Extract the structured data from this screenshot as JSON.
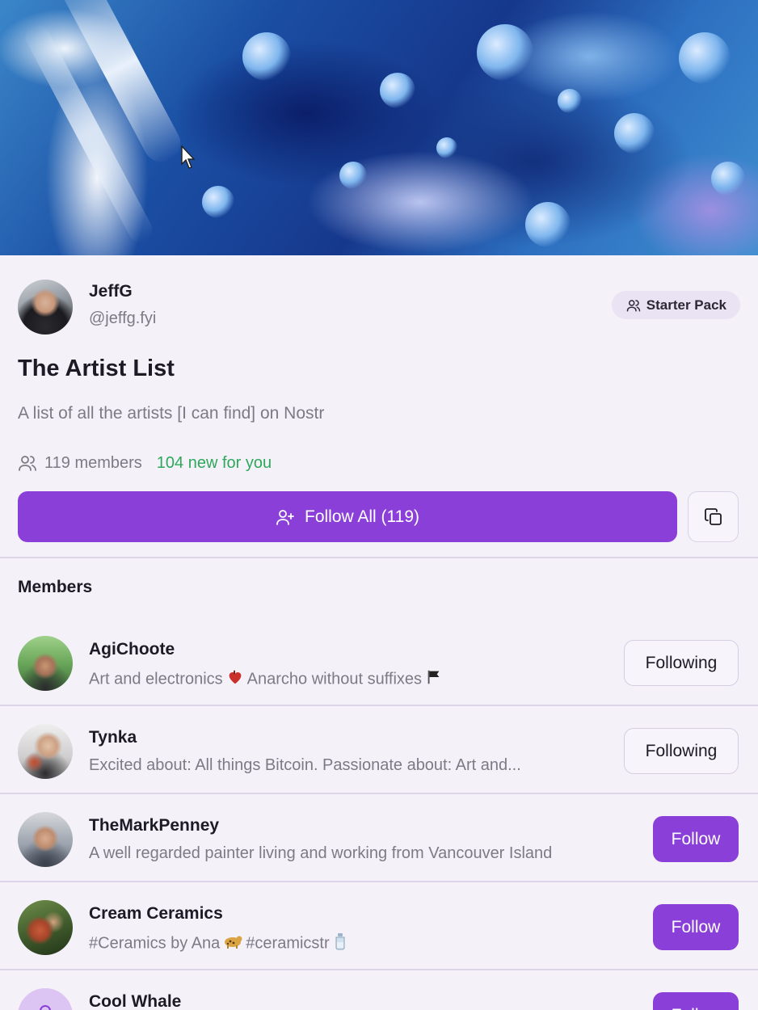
{
  "author": {
    "name": "JeffG",
    "handle": "@jeffg.fyi"
  },
  "badge": {
    "label": "Starter Pack",
    "icon": "users-icon"
  },
  "list": {
    "title": "The Artist List",
    "description": "A list of all the artists [I can find] on Nostr",
    "members_count_label": "119 members",
    "new_for_you_label": "104 new for you"
  },
  "actions": {
    "follow_all_label": "Follow All (119)",
    "follow_all_icon": "user-plus-icon",
    "copy_icon": "copy-icon"
  },
  "members_section": {
    "title": "Members"
  },
  "members": [
    {
      "name": "AgiChoote",
      "bio_a": "Art and electronics",
      "bio_b": "Anarcho without suffixes",
      "button": "Following"
    },
    {
      "name": "Tynka",
      "bio": "Excited about: All things Bitcoin. Passionate about: Art and...",
      "button": "Following"
    },
    {
      "name": "TheMarkPenney",
      "bio": "A well regarded painter living and working from Vancouver Island",
      "button": "Follow"
    },
    {
      "name": "Cream Ceramics",
      "bio_a": "#Ceramics by Ana",
      "bio_b": "#ceramicstr",
      "button": "Follow"
    },
    {
      "name": "Cool Whale",
      "button": "Follow"
    }
  ],
  "colors": {
    "accent": "#8b3fd9",
    "new_green": "#2ea85a",
    "muted_text": "#7d7a86",
    "background": "#f4f1f9"
  }
}
